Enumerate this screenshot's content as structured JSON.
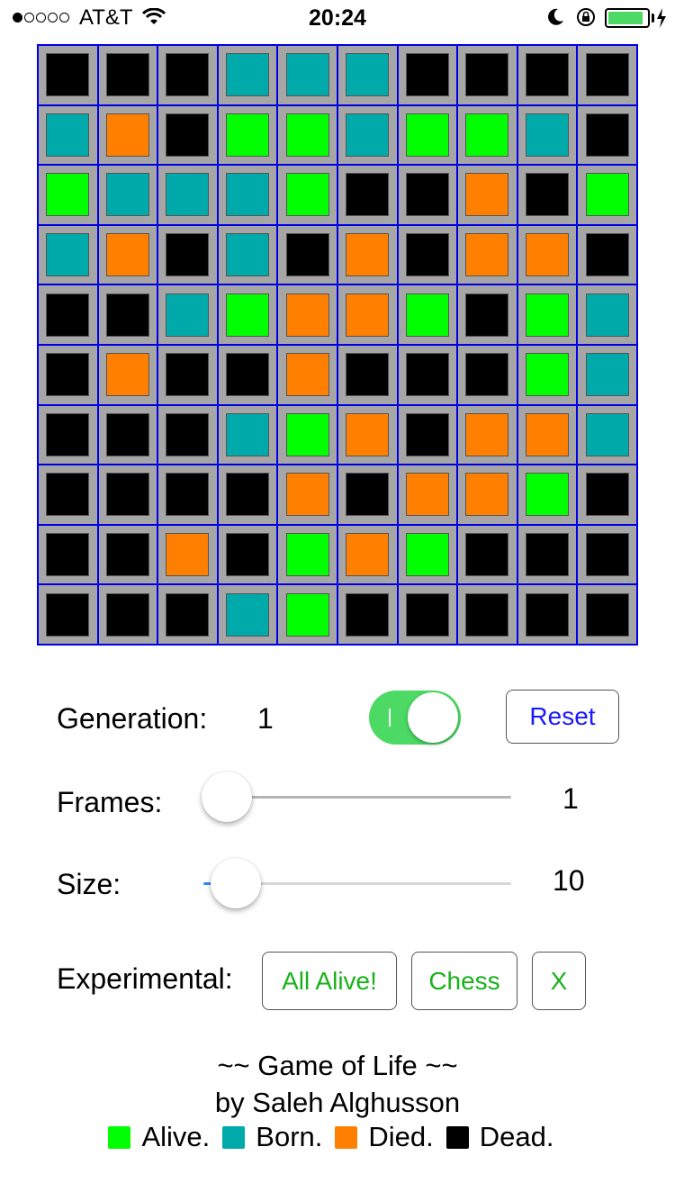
{
  "status_bar": {
    "carrier": "AT&T",
    "time": "20:24",
    "signal_bars": 1,
    "battery_level": 0.9
  },
  "colors": {
    "alive": "#00ff00",
    "born": "#00aaaa",
    "died": "#ff7f00",
    "dead": "#000000"
  },
  "grid": {
    "rows": [
      [
        "dead",
        "dead",
        "dead",
        "born",
        "born",
        "born",
        "dead",
        "dead",
        "dead",
        "dead"
      ],
      [
        "born",
        "died",
        "dead",
        "alive",
        "alive",
        "born",
        "alive",
        "alive",
        "born",
        "dead"
      ],
      [
        "alive",
        "born",
        "born",
        "born",
        "alive",
        "dead",
        "dead",
        "died",
        "dead",
        "alive"
      ],
      [
        "born",
        "died",
        "dead",
        "born",
        "dead",
        "died",
        "dead",
        "died",
        "died",
        "dead"
      ],
      [
        "dead",
        "dead",
        "born",
        "alive",
        "died",
        "died",
        "alive",
        "dead",
        "alive",
        "born"
      ],
      [
        "dead",
        "died",
        "dead",
        "dead",
        "died",
        "dead",
        "dead",
        "dead",
        "alive",
        "born"
      ],
      [
        "dead",
        "dead",
        "dead",
        "born",
        "alive",
        "died",
        "dead",
        "died",
        "died",
        "born"
      ],
      [
        "dead",
        "dead",
        "dead",
        "dead",
        "died",
        "dead",
        "died",
        "died",
        "alive",
        "dead"
      ],
      [
        "dead",
        "dead",
        "died",
        "dead",
        "alive",
        "died",
        "alive",
        "dead",
        "dead",
        "dead"
      ],
      [
        "dead",
        "dead",
        "dead",
        "born",
        "alive",
        "dead",
        "dead",
        "dead",
        "dead",
        "dead"
      ]
    ]
  },
  "controls": {
    "generation_label": "Generation:",
    "generation_value": "1",
    "toggle_on": true,
    "reset_label": "Reset",
    "frames_label": "Frames:",
    "frames_value": "1",
    "frames_level": 0.0,
    "size_label": "Size:",
    "size_value": "10",
    "size_level": 0.02,
    "experimental_label": "Experimental:",
    "all_alive_label": "All Alive!",
    "chess_label": "Chess",
    "x_label": "X"
  },
  "footer": {
    "title": "~~ Game of Life ~~",
    "byline": "by Saleh Alghusson",
    "legend": [
      {
        "state": "alive",
        "label": "Alive."
      },
      {
        "state": "born",
        "label": "Born."
      },
      {
        "state": "died",
        "label": "Died."
      },
      {
        "state": "dead",
        "label": "Dead."
      }
    ]
  }
}
